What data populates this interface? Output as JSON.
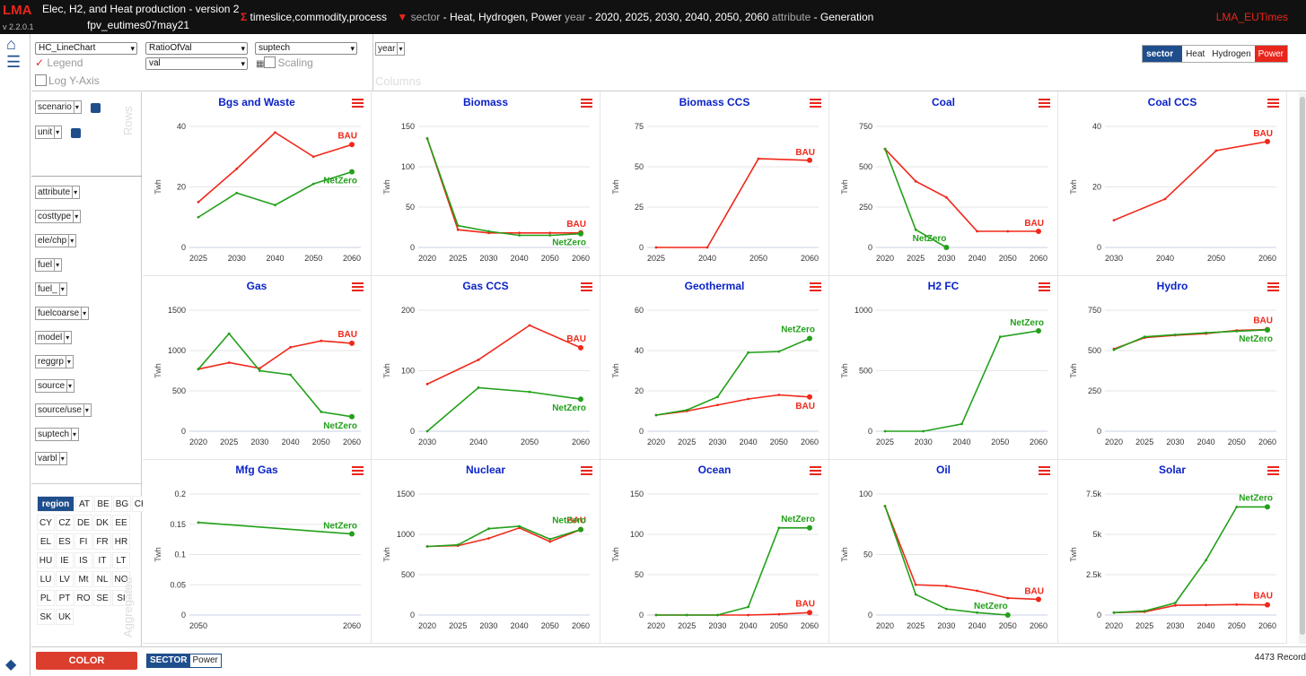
{
  "app": {
    "logo": "LMA",
    "version": "v 2.2.0.1",
    "title": "Elec, H2, and Heat production - version 2",
    "subtitle": "fpv_eutimes07may21",
    "sigma_symbol": "Σ",
    "sigma_dims": "timeslice,commodity,process",
    "filter_symbol": "▼",
    "filter_parts": [
      {
        "key": "sector",
        "value": " - Heat, Hydrogen, Power "
      },
      {
        "key": "year",
        "value": " - 2020, 2025, 2030, 2040, 2050, 2060 "
      },
      {
        "key": "attribute",
        "value": " - Generation"
      }
    ],
    "brand": "LMA_EUTimes"
  },
  "controls": {
    "chart_type": "HC_LineChart",
    "legend_check": "✓",
    "legend_label": "Legend",
    "logy_label": "Log Y-Axis",
    "measure": "RatioOfVal",
    "value": "val",
    "series_dim": "suptech",
    "scaling_label": "Scaling",
    "year_pill": "year",
    "columns_label": "Columns"
  },
  "sector_legend": {
    "title": "sector",
    "items": [
      {
        "label": "Heat",
        "active": false
      },
      {
        "label": "Hydrogen",
        "active": false
      },
      {
        "label": "Power",
        "active": true
      }
    ]
  },
  "sidebar": {
    "rows_label": "Rows",
    "aggregated_label": "Aggregated",
    "row_pills": [
      "scenario",
      "unit"
    ],
    "attr_pills": [
      "attribute",
      "costtype",
      "ele/chp",
      "fuel",
      "fuel_",
      "fuelcoarse",
      "model",
      "reggrp",
      "source",
      "source/use",
      "suptech",
      "varbl"
    ],
    "regions": [
      "region",
      "AT",
      "BE",
      "BG",
      "CH",
      "CY",
      "CZ",
      "DE",
      "DK",
      "EE",
      "EL",
      "ES",
      "FI",
      "FR",
      "HR",
      "HU",
      "IE",
      "IS",
      "IT",
      "LT",
      "LU",
      "LV",
      "Mt",
      "NL",
      "NO",
      "PL",
      "PT",
      "RO",
      "SE",
      "SI",
      "SK",
      "UK"
    ]
  },
  "bottom": {
    "color_button": "COLOR",
    "chip_key": "SECTOR",
    "chip_value": "Power",
    "records": "4473 Record"
  },
  "colors": {
    "bau": "#f0281a",
    "netzero": "#22a01a",
    "title": "#0b23c8",
    "accent": "#1f4e8c"
  },
  "y_axis_label": "Twh",
  "chart_data": [
    {
      "type": "line",
      "title": "Bgs and Waste",
      "x": [
        2025,
        2030,
        2040,
        2050,
        2060
      ],
      "ylim": [
        0,
        40
      ],
      "yticks": [
        "0",
        "20",
        "40"
      ],
      "series": [
        {
          "name": "BAU",
          "values": [
            15,
            26,
            38,
            30,
            34
          ]
        },
        {
          "name": "NetZero",
          "values": [
            10,
            18,
            14,
            21,
            25
          ]
        }
      ]
    },
    {
      "type": "line",
      "title": "Biomass",
      "x": [
        2020,
        2025,
        2030,
        2040,
        2050,
        2060
      ],
      "ylim": [
        0,
        150
      ],
      "yticks": [
        "0",
        "50",
        "100",
        "150"
      ],
      "series": [
        {
          "name": "BAU",
          "values": [
            135,
            22,
            18,
            18,
            18,
            18
          ]
        },
        {
          "name": "NetZero",
          "values": [
            135,
            27,
            20,
            15,
            15,
            17
          ]
        }
      ]
    },
    {
      "type": "line",
      "title": "Biomass CCS",
      "x": [
        2025,
        2040,
        2050,
        2060
      ],
      "ylim": [
        0,
        75
      ],
      "yticks": [
        "0",
        "25",
        "50",
        "75"
      ],
      "series": [
        {
          "name": "BAU",
          "values": [
            0,
            0,
            55,
            54
          ]
        }
      ]
    },
    {
      "type": "line",
      "title": "Coal",
      "x": [
        2020,
        2025,
        2030,
        2040,
        2050,
        2060
      ],
      "ylim": [
        0,
        750
      ],
      "yticks": [
        "0",
        "250",
        "500",
        "750"
      ],
      "series": [
        {
          "name": "BAU",
          "values": [
            610,
            410,
            310,
            100,
            100,
            100
          ]
        },
        {
          "name": "NetZero",
          "values": [
            610,
            110,
            0,
            null,
            null,
            null
          ]
        }
      ]
    },
    {
      "type": "line",
      "title": "Coal CCS",
      "x": [
        2030,
        2040,
        2050,
        2060
      ],
      "ylim": [
        0,
        40
      ],
      "yticks": [
        "0",
        "20",
        "40"
      ],
      "series": [
        {
          "name": "BAU",
          "values": [
            9,
            16,
            32,
            35
          ]
        }
      ]
    },
    {
      "type": "line",
      "title": "Gas",
      "x": [
        2020,
        2025,
        2030,
        2040,
        2050,
        2060
      ],
      "ylim": [
        0,
        1500
      ],
      "yticks": [
        "0",
        "500",
        "1000",
        "1500"
      ],
      "series": [
        {
          "name": "BAU",
          "values": [
            770,
            850,
            780,
            1040,
            1120,
            1090
          ]
        },
        {
          "name": "NetZero",
          "values": [
            770,
            1210,
            750,
            700,
            240,
            180
          ]
        }
      ]
    },
    {
      "type": "line",
      "title": "Gas CCS",
      "x": [
        2030,
        2040,
        2050,
        2060
      ],
      "ylim": [
        0,
        200
      ],
      "yticks": [
        "0",
        "100",
        "200"
      ],
      "series": [
        {
          "name": "BAU",
          "values": [
            78,
            118,
            175,
            138
          ]
        },
        {
          "name": "NetZero",
          "values": [
            0,
            72,
            65,
            53
          ]
        }
      ]
    },
    {
      "type": "line",
      "title": "Geothermal",
      "x": [
        2020,
        2025,
        2030,
        2040,
        2050,
        2060
      ],
      "ylim": [
        0,
        60
      ],
      "yticks": [
        "0",
        "20",
        "40",
        "60"
      ],
      "series": [
        {
          "name": "BAU",
          "values": [
            8,
            10,
            13,
            16,
            18,
            17
          ]
        },
        {
          "name": "NetZero",
          "values": [
            8,
            10.5,
            17,
            39,
            39.5,
            46
          ]
        }
      ]
    },
    {
      "type": "line",
      "title": "H2 FC",
      "x": [
        2025,
        2030,
        2040,
        2050,
        2060
      ],
      "ylim": [
        0,
        1000
      ],
      "yticks": [
        "0",
        "500",
        "1000"
      ],
      "series": [
        {
          "name": "NetZero",
          "values": [
            0,
            0,
            60,
            780,
            830
          ]
        }
      ]
    },
    {
      "type": "line",
      "title": "Hydro",
      "x": [
        2020,
        2025,
        2030,
        2040,
        2050,
        2060
      ],
      "ylim": [
        0,
        750
      ],
      "yticks": [
        "0",
        "250",
        "500",
        "750"
      ],
      "series": [
        {
          "name": "BAU",
          "values": [
            510,
            580,
            595,
            605,
            625,
            630
          ]
        },
        {
          "name": "NetZero",
          "values": [
            505,
            585,
            598,
            610,
            620,
            628
          ]
        }
      ]
    },
    {
      "type": "line",
      "title": "Mfg Gas",
      "x": [
        2050,
        2060
      ],
      "ylim": [
        0,
        0.2
      ],
      "yticks": [
        "0",
        "0.05",
        "0.1",
        "0.15",
        "0.2"
      ],
      "series": [
        {
          "name": "NetZero",
          "values": [
            0.153,
            0.134
          ]
        }
      ]
    },
    {
      "type": "line",
      "title": "Nuclear",
      "x": [
        2020,
        2025,
        2030,
        2040,
        2050,
        2060
      ],
      "ylim": [
        0,
        1500
      ],
      "yticks": [
        "0",
        "500",
        "1000",
        "1500"
      ],
      "series": [
        {
          "name": "BAU",
          "values": [
            850,
            860,
            950,
            1080,
            910,
            1060
          ]
        },
        {
          "name": "NetZero",
          "values": [
            850,
            870,
            1070,
            1100,
            940,
            1060
          ]
        }
      ]
    },
    {
      "type": "line",
      "title": "Ocean",
      "x": [
        2020,
        2025,
        2030,
        2040,
        2050,
        2060
      ],
      "ylim": [
        0,
        150
      ],
      "yticks": [
        "0",
        "50",
        "100",
        "150"
      ],
      "series": [
        {
          "name": "BAU",
          "values": [
            0,
            0,
            0,
            0,
            1,
            3
          ]
        },
        {
          "name": "NetZero",
          "values": [
            0,
            0,
            0,
            10,
            108,
            108
          ]
        }
      ]
    },
    {
      "type": "line",
      "title": "Oil",
      "x": [
        2020,
        2025,
        2030,
        2040,
        2050,
        2060
      ],
      "ylim": [
        0,
        100
      ],
      "yticks": [
        "0",
        "50",
        "100"
      ],
      "series": [
        {
          "name": "BAU",
          "values": [
            90,
            25,
            24,
            20,
            14,
            13
          ]
        },
        {
          "name": "NetZero",
          "values": [
            90,
            17,
            5,
            2,
            0,
            null
          ]
        }
      ]
    },
    {
      "type": "line",
      "title": "Solar",
      "x": [
        2020,
        2025,
        2030,
        2040,
        2050,
        2060
      ],
      "ylim": [
        0,
        7500
      ],
      "yticks": [
        "0",
        "2.5k",
        "5k",
        "7.5k"
      ],
      "series": [
        {
          "name": "BAU",
          "values": [
            150,
            200,
            600,
            620,
            650,
            630
          ]
        },
        {
          "name": "NetZero",
          "values": [
            150,
            250,
            750,
            3400,
            6700,
            6700
          ]
        }
      ]
    }
  ]
}
